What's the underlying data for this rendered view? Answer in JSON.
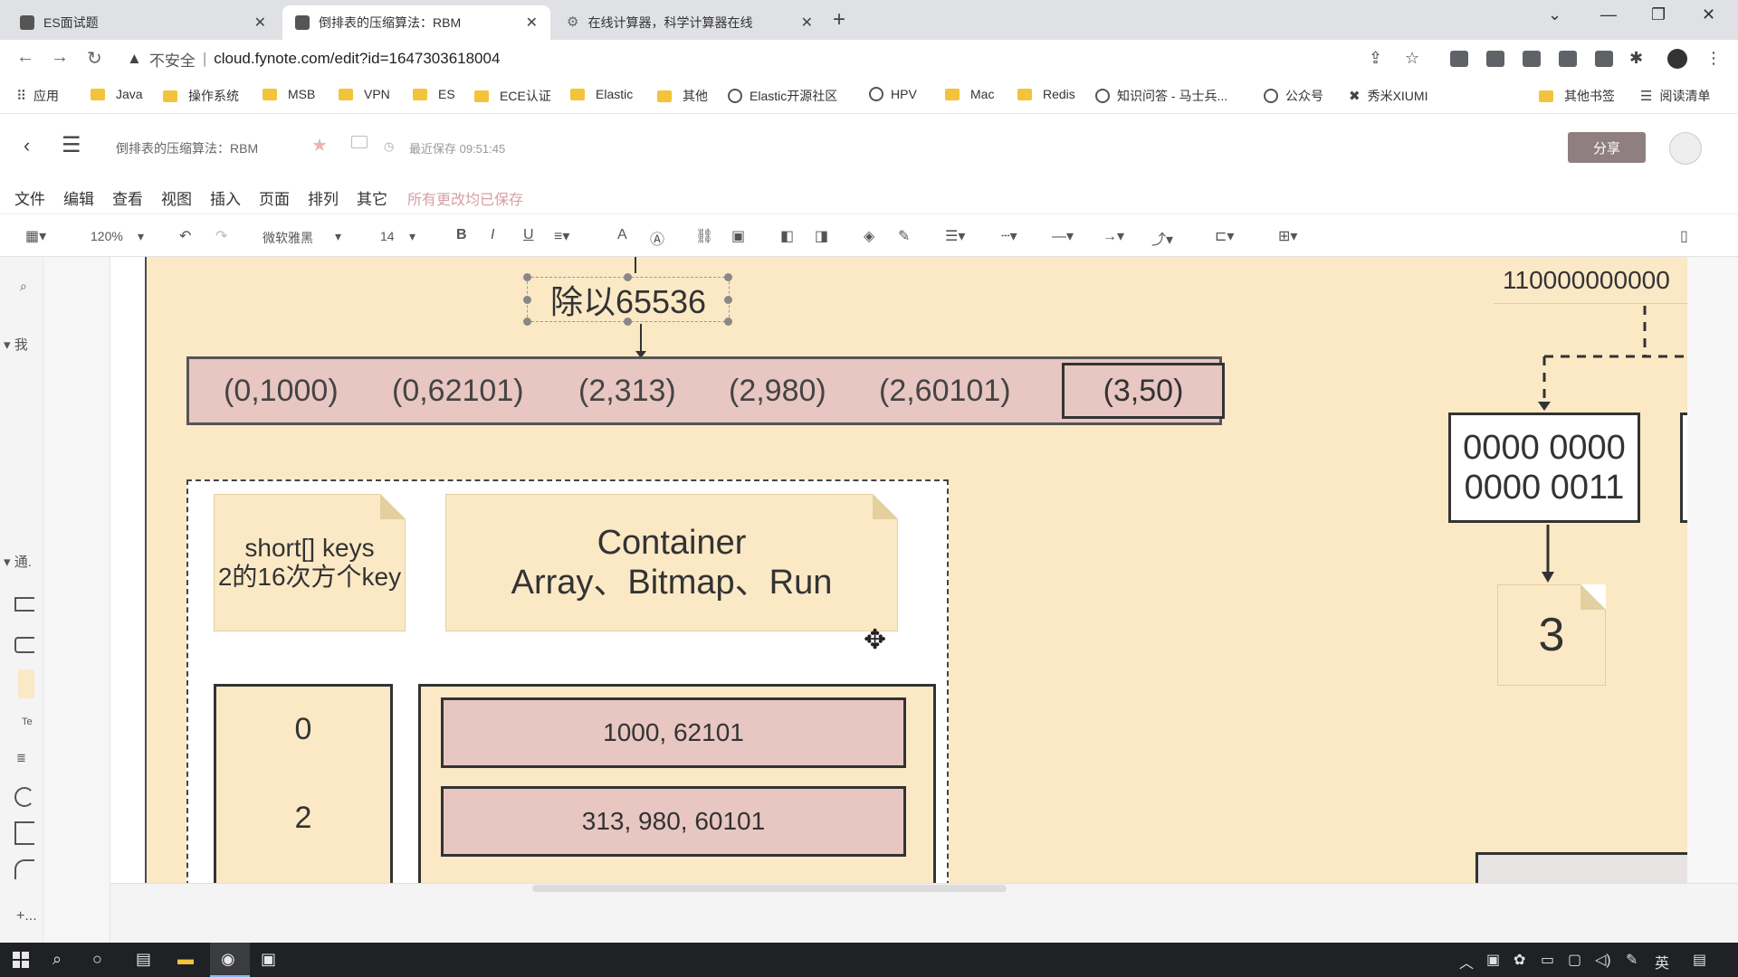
{
  "browser": {
    "tabs": [
      {
        "label": "ES面试题",
        "icon": "page-icon"
      },
      {
        "label": "倒排表的压缩算法：RBM",
        "icon": "page-icon"
      },
      {
        "label": "在线计算器，科学计算器在线",
        "icon": "gear-icon"
      }
    ],
    "url_warning": "不安全",
    "url": "cloud.fynote.com/edit?id=1647303618004",
    "bookmarks": [
      "应用",
      "Java",
      "操作系统",
      "MSB",
      "VPN",
      "ES",
      "ECE认证",
      "Elastic",
      "其他",
      "Elastic开源社区",
      "HPV",
      "Mac",
      "Redis",
      "知识问答 - 马士兵...",
      "公众号",
      "秀米XIUMI",
      "其他书签",
      "阅读清单"
    ]
  },
  "app": {
    "doc_title": "倒排表的压缩算法：RBM",
    "save_status": "最近保存 09:51:45",
    "share_label": "分享",
    "menu": [
      "文件",
      "编辑",
      "查看",
      "视图",
      "插入",
      "页面",
      "排列",
      "其它"
    ],
    "all_saved": "所有更改均已保存",
    "toolbar": {
      "zoom": "120%",
      "font": "微软雅黑",
      "size": "14"
    }
  },
  "sidebar": {
    "section1": "我",
    "section2": "通.",
    "text_tool": "Te"
  },
  "canvas": {
    "divide_label": "除以65536",
    "pairs": [
      "(0,1000)",
      "(0,62101)",
      "(2,313)",
      "(2,980)",
      "(2,60101)"
    ],
    "last_pair": "(3,50)",
    "keys_note": [
      "short[] keys",
      "2的16次方个key"
    ],
    "container_note": [
      "Container",
      "Array、Bitmap、Run"
    ],
    "index_values": [
      "0",
      "2"
    ],
    "container_values": [
      "1000, 62101",
      "313, 980, 60101"
    ],
    "right_number": "110000000000",
    "binary_lines": [
      "0000 0000",
      "0000 0011"
    ],
    "three_note": "3"
  },
  "taskbar": {
    "lang": "英"
  }
}
